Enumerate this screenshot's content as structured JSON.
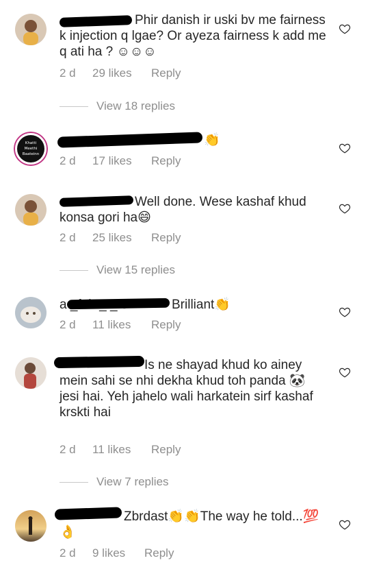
{
  "comments": [
    {
      "text": "Phir danish ir uski bv me fairness k injection q lgae? Or ayeza fairness k add me q ati ha ? ☺☺☺",
      "time": "2 d",
      "likes": "29 likes",
      "reply": "Reply",
      "view_replies": "View 18 replies"
    },
    {
      "avatar_text": [
        "Khatti",
        "Meethi",
        "Baateinn"
      ],
      "text": "👏",
      "time": "2 d",
      "likes": "17 likes",
      "reply": "Reply"
    },
    {
      "text": "Well done. Wese kashaf khud konsa gori ha😄",
      "time": "2 d",
      "likes": "25 likes",
      "reply": "Reply",
      "view_replies": "View 15 replies"
    },
    {
      "username_visible": "a          _f     th       _     _  5",
      "text": "Brilliant👏",
      "time": "2 d",
      "likes": "11 likes",
      "reply": "Reply"
    },
    {
      "text": "Is ne shayad khud ko ainey mein sahi se nhi dekha khud toh panda 🐼 jesi hai. Yeh jahelo wali harkatein sirf kashaf krskti hai",
      "time": "2 d",
      "likes": "11 likes",
      "reply": "Reply",
      "view_replies": "View 7 replies"
    },
    {
      "text": "Zbrdast👏👏The way he told...💯👌",
      "time": "2 d",
      "likes": "9 likes",
      "reply": "Reply"
    }
  ],
  "icons": {
    "like": "heart-outline-icon"
  },
  "colors": {
    "text": "#262626",
    "meta": "#8e8e8e",
    "divider": "#c7c7c7"
  }
}
